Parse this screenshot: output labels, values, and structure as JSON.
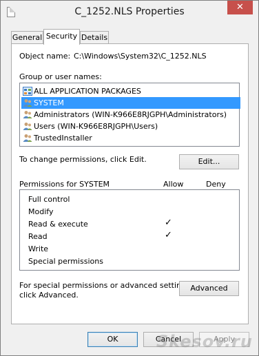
{
  "window": {
    "title": "C_1252.NLS Properties",
    "close_glyph": "✕"
  },
  "tabs": [
    {
      "label": "General"
    },
    {
      "label": "Security"
    },
    {
      "label": "Details"
    }
  ],
  "object": {
    "label": "Object name:",
    "value": "C:\\Windows\\System32\\C_1252.NLS"
  },
  "groups": {
    "label": "Group or user names:",
    "items": [
      {
        "label": "ALL APPLICATION PACKAGES",
        "icon": "app-packages-icon"
      },
      {
        "label": "SYSTEM",
        "icon": "users-icon",
        "selected": true
      },
      {
        "label": "Administrators (WIN-K966E8RJGPH\\Administrators)",
        "icon": "users-icon"
      },
      {
        "label": "Users (WIN-K966E8RJGPH\\Users)",
        "icon": "users-icon"
      },
      {
        "label": "TrustedInstaller",
        "icon": "users-icon"
      }
    ]
  },
  "change_hint": "To change permissions, click Edit.",
  "edit_label": "Edit...",
  "permissions": {
    "header": "Permissions for SYSTEM",
    "allow": "Allow",
    "deny": "Deny",
    "check_glyph": "✓",
    "rows": [
      {
        "label": "Full control",
        "allow": false,
        "deny": false
      },
      {
        "label": "Modify",
        "allow": false,
        "deny": false
      },
      {
        "label": "Read & execute",
        "allow": true,
        "deny": false
      },
      {
        "label": "Read",
        "allow": true,
        "deny": false
      },
      {
        "label": "Write",
        "allow": false,
        "deny": false
      },
      {
        "label": "Special permissions",
        "allow": false,
        "deny": false
      }
    ]
  },
  "advanced_hint_line1": "For special permissions or advanced settings,",
  "advanced_hint_line2": "click Advanced.",
  "advanced_label": "Advanced",
  "footer": {
    "ok": "OK",
    "cancel": "Cancel",
    "apply": "Apply"
  },
  "watermark": "Skesov.ru",
  "colors": {
    "selection": "#3399ff",
    "close": "#c7504b"
  }
}
